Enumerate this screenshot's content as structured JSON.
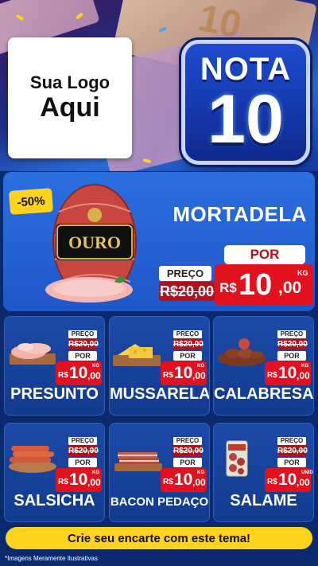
{
  "header": {
    "logo_line1": "Sua Logo",
    "logo_line2": "Aqui",
    "badge_line1": "NOTA",
    "badge_line2": "10"
  },
  "hero": {
    "discount": "-50%",
    "product": "MORTADELA",
    "package_brand": "OURO",
    "preco_label": "PREÇO",
    "old_price": "R$20,00",
    "por_label": "POR",
    "currency": "R$",
    "price_int": "10",
    "price_dec": ",00",
    "unit": "KG"
  },
  "cards": [
    {
      "name": "PRESUNTO",
      "preco_label": "PREÇO",
      "old_price": "R$20,00",
      "por_label": "POR",
      "currency": "R$",
      "price_int": "10",
      "price_dec": ",00",
      "unit": "KG",
      "icon": "ham-slices-icon"
    },
    {
      "name": "MUSSARELA",
      "preco_label": "PREÇO",
      "old_price": "R$20,00",
      "por_label": "POR",
      "currency": "R$",
      "price_int": "10",
      "price_dec": ",00",
      "unit": "KG",
      "icon": "cheese-icon"
    },
    {
      "name": "CALABRESA",
      "preco_label": "PREÇO",
      "old_price": "R$20,00",
      "por_label": "POR",
      "currency": "R$",
      "price_int": "10",
      "price_dec": ",00",
      "unit": "KG",
      "icon": "sausage-ring-icon"
    },
    {
      "name": "SALSICHA",
      "preco_label": "PREÇO",
      "old_price": "R$20,00",
      "por_label": "POR",
      "currency": "R$",
      "price_int": "10",
      "price_dec": ",00",
      "unit": "KG",
      "icon": "hotdog-sausage-icon"
    },
    {
      "name": "BACON PEDAÇO",
      "preco_label": "PREÇO",
      "old_price": "R$20,00",
      "por_label": "POR",
      "currency": "R$",
      "price_int": "10",
      "price_dec": ",00",
      "unit": "KG",
      "icon": "bacon-icon"
    },
    {
      "name": "SALAME",
      "preco_label": "PREÇO",
      "old_price": "R$20,00",
      "por_label": "POR",
      "currency": "R$",
      "price_int": "10",
      "price_dec": ",00",
      "unit": "UNID",
      "icon": "salami-pack-icon"
    }
  ],
  "footer": {
    "cta": "Crie seu encarte com este tema!",
    "disclaimer": "*Imagens Meramente Ilustrativas"
  },
  "colors": {
    "brand_blue": "#1f57c9",
    "price_red": "#e3101d",
    "old_price_red": "#b3101c",
    "yellow": "#ffd21c"
  }
}
